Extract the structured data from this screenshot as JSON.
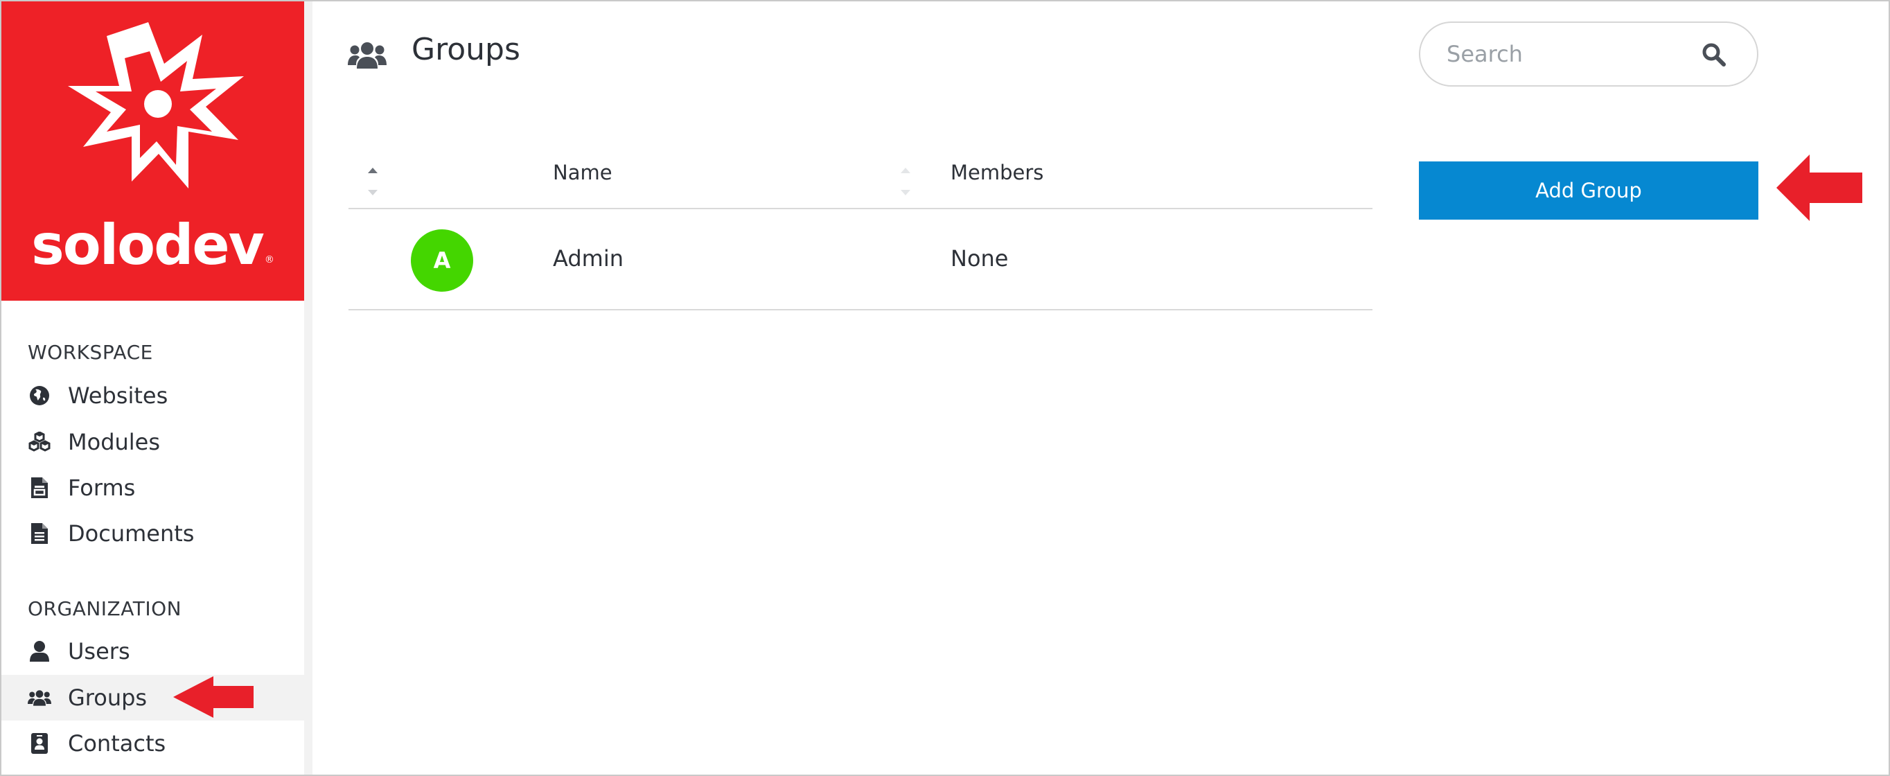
{
  "brand": {
    "name": "solodev",
    "trademark": "®",
    "color": "#ee2127"
  },
  "sidebar": {
    "sections": [
      {
        "title": "WORKSPACE",
        "items": [
          {
            "label": "Websites",
            "icon": "globe-icon"
          },
          {
            "label": "Modules",
            "icon": "cubes-icon"
          },
          {
            "label": "Forms",
            "icon": "form-icon"
          },
          {
            "label": "Documents",
            "icon": "document-icon"
          }
        ]
      },
      {
        "title": "ORGANIZATION",
        "items": [
          {
            "label": "Users",
            "icon": "user-icon"
          },
          {
            "label": "Groups",
            "icon": "users-icon",
            "active": true
          },
          {
            "label": "Contacts",
            "icon": "contact-card-icon"
          }
        ]
      }
    ]
  },
  "page": {
    "title": "Groups",
    "icon": "users-icon"
  },
  "search": {
    "placeholder": "Search",
    "value": ""
  },
  "table": {
    "columns": [
      "",
      "Name",
      "Members"
    ],
    "rows": [
      {
        "avatar_letter": "A",
        "avatar_color": "#44d600",
        "name": "Admin",
        "members": "None"
      }
    ]
  },
  "actions": {
    "add_group_label": "Add Group",
    "button_color": "#0688d1"
  },
  "annotations": {
    "arrow_color": "#e8202a"
  }
}
